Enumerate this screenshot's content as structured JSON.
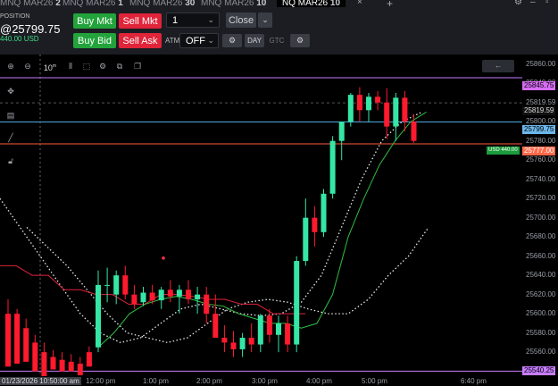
{
  "tabs": [
    {
      "label": "MNQ MAR26",
      "suffix": "2"
    },
    {
      "label": "MNQ MAR26",
      "suffix": "1"
    },
    {
      "label": "MNQ MAR26",
      "suffix": "30"
    },
    {
      "label": "MNQ MAR26",
      "suffix": "10"
    },
    {
      "label": "NQ MAR26",
      "suffix": "10"
    }
  ],
  "add_tab": "+",
  "position": {
    "label": "POSITION",
    "price": "@25799.75",
    "value": "440.00 USD"
  },
  "buttons": {
    "buy_mkt": "Buy Mkt",
    "sell_mkt": "Sell Mkt",
    "buy_bid": "Buy Bid",
    "sell_ask": "Sell Ask",
    "close": "Close",
    "atm": "ATM",
    "atm_value": "OFF",
    "day": "DAY",
    "gtc": "GTC"
  },
  "quantity": "1",
  "toolbar": {
    "interval": "10"
  },
  "price_labels": [
    "25860.00",
    "25840.00",
    "25819.59",
    "25800.00",
    "25780.00",
    "25760.00",
    "25740.00",
    "25720.00",
    "25700.00",
    "25680.00",
    "25660.00",
    "25640.00",
    "25620.00",
    "25600.00",
    "25580.00",
    "25560.00",
    "25540.00"
  ],
  "tags": {
    "top": "25845.75",
    "entry": "25799.75",
    "last": "25777.00",
    "pnl": "USD 440.00",
    "bottom": "25540.25",
    "mid": "25819.59"
  },
  "time_labels": [
    "12:00 pm",
    "1:00 pm",
    "2:00 pm",
    "3:00 pm",
    "4:00 pm",
    "5:00 pm",
    "6:40 pm"
  ],
  "cursor_time": "01/23/2026 10:50:00 am",
  "colors": {
    "up": "#35e6a6",
    "down": "#ff1a2e",
    "entry_line": "#4aa9e0",
    "stop_line": "#ff5a3c",
    "limit_line": "#c77dff"
  },
  "chart_data": {
    "type": "candlestick",
    "ylim": [
      25535,
      25870
    ],
    "candles": [
      [
        25600,
        25615,
        25570,
        25545
      ],
      [
        25600,
        25605,
        25560,
        25548
      ],
      [
        25585,
        25595,
        25560,
        25550
      ],
      [
        25570,
        25578,
        25545,
        25540
      ],
      [
        25560,
        25570,
        25540,
        25535
      ],
      [
        25555,
        25562,
        25548,
        25542
      ],
      [
        25552,
        25560,
        25545,
        25540
      ],
      [
        25550,
        25558,
        25542,
        25540
      ],
      [
        25548,
        25555,
        25540,
        25536
      ],
      [
        25560,
        25566,
        25548,
        25545
      ],
      [
        25565,
        25645,
        25560,
        25630
      ],
      [
        25630,
        25648,
        25612,
        25630
      ],
      [
        25620,
        25645,
        25610,
        25640
      ],
      [
        25640,
        25650,
        25615,
        25620
      ],
      [
        25620,
        25630,
        25605,
        25610
      ],
      [
        25612,
        25628,
        25608,
        25622
      ],
      [
        25622,
        25630,
        25610,
        25614
      ],
      [
        25614,
        25628,
        25605,
        25625
      ],
      [
        25625,
        25635,
        25612,
        25618
      ],
      [
        25618,
        25630,
        25600,
        25625
      ],
      [
        25625,
        25635,
        25610,
        25615
      ],
      [
        25615,
        25628,
        25600,
        25620
      ],
      [
        25620,
        25628,
        25590,
        25600
      ],
      [
        25600,
        25620,
        25585,
        25575
      ],
      [
        25575,
        25588,
        25560,
        25570
      ],
      [
        25570,
        25582,
        25555,
        25563
      ],
      [
        25563,
        25580,
        25555,
        25575
      ],
      [
        25575,
        25590,
        25560,
        25568
      ],
      [
        25568,
        25600,
        25560,
        25598
      ],
      [
        25598,
        25605,
        25570,
        25578
      ],
      [
        25578,
        25598,
        25560,
        25590
      ],
      [
        25590,
        25598,
        25560,
        25568
      ],
      [
        25568,
        25660,
        25560,
        25655
      ],
      [
        25655,
        25720,
        25650,
        25700
      ],
      [
        25700,
        25712,
        25670,
        25685
      ],
      [
        25685,
        25730,
        25680,
        25725
      ],
      [
        25725,
        25785,
        25720,
        25780
      ],
      [
        25780,
        25800,
        25760,
        25800
      ],
      [
        25800,
        25830,
        25795,
        25828
      ],
      [
        25828,
        25836,
        25800,
        25812
      ],
      [
        25812,
        25830,
        25800,
        25826
      ],
      [
        25826,
        25832,
        25812,
        25820
      ],
      [
        25820,
        25835,
        25782,
        25795
      ],
      [
        25795,
        25830,
        25780,
        25825
      ],
      [
        25825,
        25832,
        25790,
        25800
      ],
      [
        25800,
        25808,
        25778,
        25780
      ]
    ],
    "stop_trail": [
      25650,
      25650,
      25640,
      25640,
      25625,
      25625,
      25620,
      25620,
      25610,
      25610,
      25620,
      25620,
      25618,
      25615,
      25615,
      25610,
      25610,
      25600,
      25600,
      25600
    ],
    "ema_fast": [
      25565,
      25580,
      25600,
      25610,
      25615,
      25618,
      25615,
      25610,
      25608,
      25600,
      25595,
      25590,
      25590,
      25585,
      25590,
      25620,
      25680,
      25720,
      25755,
      25780,
      25800,
      25810
    ],
    "dotted_mid": [
      25720,
      25690,
      25660,
      25630,
      25600,
      25580,
      25570,
      25575,
      25590,
      25605,
      25610,
      25605,
      25600,
      25598,
      25600,
      25612,
      25640,
      25690,
      25740,
      25780,
      25800,
      25810
    ],
    "dotted_slow": [
      25690,
      25670,
      25650,
      25625,
      25600,
      25580,
      25575,
      25570,
      25575,
      25590,
      25605,
      25612,
      25615,
      25612,
      25605,
      25600,
      25600,
      25615,
      25640,
      25660,
      25690
    ],
    "entry_price": 25799.75,
    "last_price": 25777.0,
    "limit_price": 25845.75
  }
}
